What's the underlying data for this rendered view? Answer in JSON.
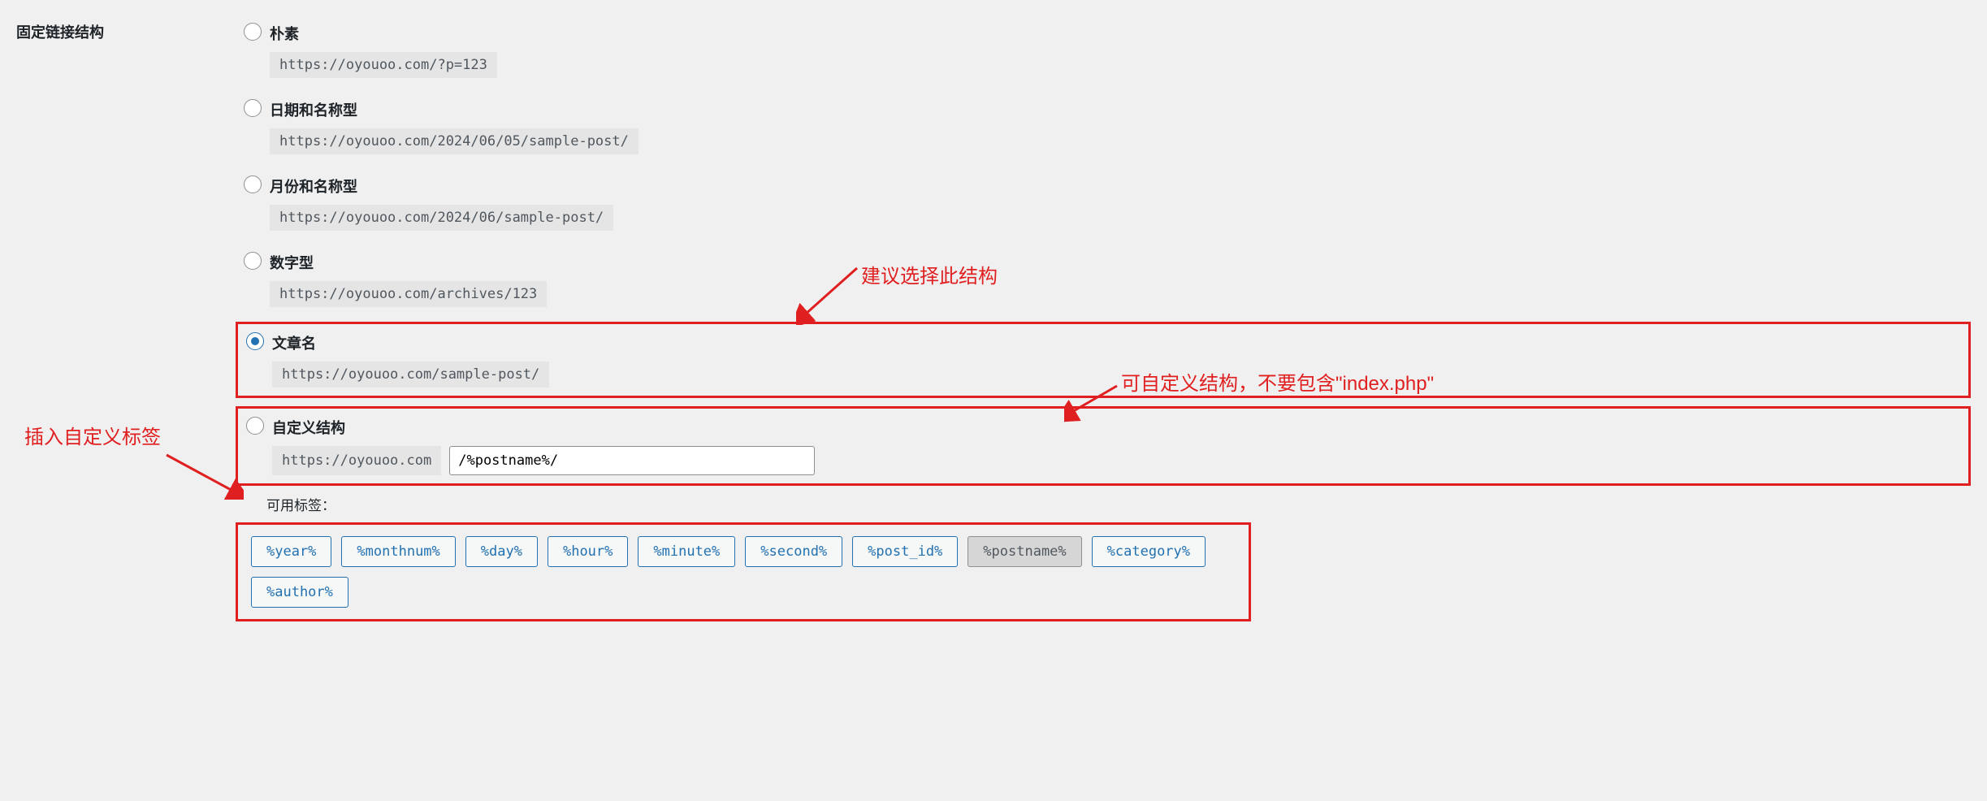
{
  "section_title": "固定链接结构",
  "options": {
    "plain": {
      "label": "朴素",
      "url": "https://oyouoo.com/?p=123",
      "selected": false
    },
    "day_name": {
      "label": "日期和名称型",
      "url": "https://oyouoo.com/2024/06/05/sample-post/",
      "selected": false
    },
    "month_name": {
      "label": "月份和名称型",
      "url": "https://oyouoo.com/2024/06/sample-post/",
      "selected": false
    },
    "numeric": {
      "label": "数字型",
      "url": "https://oyouoo.com/archives/123",
      "selected": false
    },
    "post_name": {
      "label": "文章名",
      "url": "https://oyouoo.com/sample-post/",
      "selected": true
    },
    "custom": {
      "label": "自定义结构",
      "prefix": "https://oyouoo.com",
      "value": "/%postname%/",
      "selected": false
    }
  },
  "tags_label": "可用标签：",
  "tags": [
    {
      "text": "%year%",
      "active": false
    },
    {
      "text": "%monthnum%",
      "active": false
    },
    {
      "text": "%day%",
      "active": false
    },
    {
      "text": "%hour%",
      "active": false
    },
    {
      "text": "%minute%",
      "active": false
    },
    {
      "text": "%second%",
      "active": false
    },
    {
      "text": "%post_id%",
      "active": false
    },
    {
      "text": "%postname%",
      "active": true
    },
    {
      "text": "%category%",
      "active": false
    },
    {
      "text": "%author%",
      "active": false
    }
  ],
  "annotations": {
    "suggest": "建议选择此结构",
    "custom_note": "可自定义结构，不要包含\"index.php\"",
    "insert_tag": "插入自定义标签"
  }
}
